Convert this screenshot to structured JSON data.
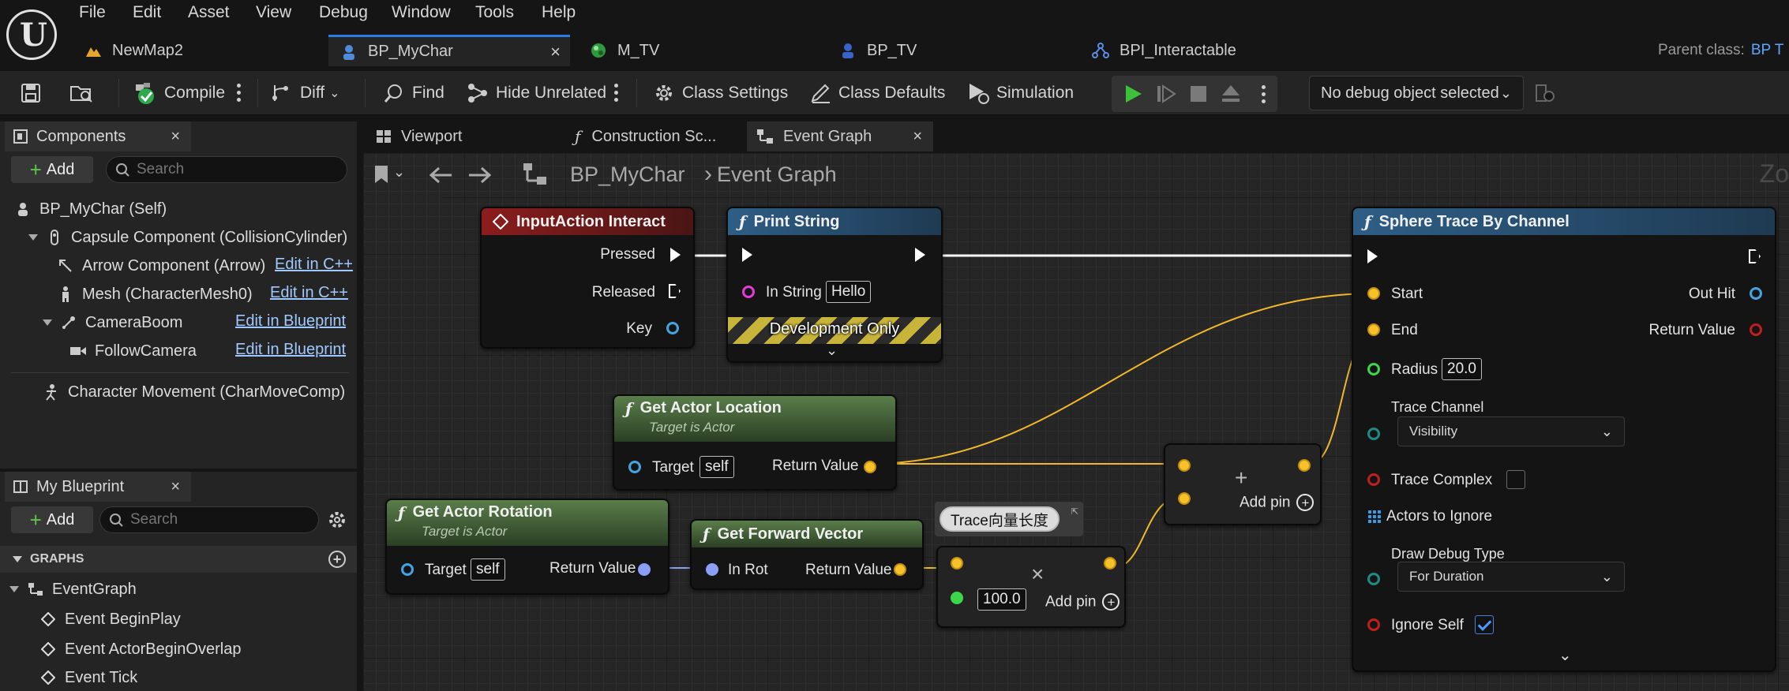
{
  "menubar": {
    "items": [
      "File",
      "Edit",
      "Asset",
      "View",
      "Debug",
      "Window",
      "Tools",
      "Help"
    ]
  },
  "doc_tabs": [
    {
      "label": "NewMap2"
    },
    {
      "label": "BP_MyChar",
      "close": "×"
    },
    {
      "label": "M_TV"
    },
    {
      "label": "BP_TV"
    },
    {
      "label": "BPI_Interactable"
    }
  ],
  "parent_class": {
    "label": "Parent class:",
    "value": "BP T"
  },
  "toolbar": {
    "compile": "Compile",
    "diff": "Diff",
    "find": "Find",
    "hide_unrelated": "Hide Unrelated",
    "class_settings": "Class Settings",
    "class_defaults": "Class Defaults",
    "simulation": "Simulation",
    "debug_object": "No debug object selected"
  },
  "components": {
    "tab_label": "Components",
    "close": "×",
    "add_label": "Add",
    "search_placeholder": "Search",
    "tree": [
      {
        "label": "BP_MyChar (Self)"
      },
      {
        "label": "Capsule Component (CollisionCylinder)"
      },
      {
        "label": "Arrow Component (Arrow)",
        "link": "Edit in C++"
      },
      {
        "label": "Mesh (CharacterMesh0)",
        "link": "Edit in C++"
      },
      {
        "label": "CameraBoom",
        "link": "Edit in Blueprint"
      },
      {
        "label": "FollowCamera",
        "link": "Edit in Blueprint"
      },
      {
        "label": "Character Movement (CharMoveComp)"
      }
    ]
  },
  "my_blueprint": {
    "tab_label": "My Blueprint",
    "close": "×",
    "add_label": "Add",
    "search_placeholder": "Search",
    "graphs_header": "GRAPHS",
    "items": [
      "EventGraph",
      "Event BeginPlay",
      "Event ActorBeginOverlap",
      "Event Tick"
    ]
  },
  "graph_tabs": [
    {
      "label": "Viewport"
    },
    {
      "label": "Construction Sc..."
    },
    {
      "label": "Event Graph",
      "close": "×"
    }
  ],
  "breadcrumb": {
    "root": "BP_MyChar",
    "current": "Event Graph",
    "zoom": "Zo"
  },
  "nodes": {
    "input_action": {
      "title": "InputAction Interact",
      "pins": [
        "Pressed",
        "Released",
        "Key"
      ]
    },
    "print_string": {
      "title": "Print String",
      "in_string_label": "In String",
      "in_string_value": "Hello",
      "dev_only": "Development Only"
    },
    "get_actor_location": {
      "title": "Get Actor Location",
      "subtitle": "Target is Actor",
      "target_label": "Target",
      "target_value": "self",
      "return_label": "Return Value"
    },
    "get_actor_rotation": {
      "title": "Get Actor Rotation",
      "subtitle": "Target is Actor",
      "target_label": "Target",
      "target_value": "self",
      "return_label": "Return Value"
    },
    "get_forward_vector": {
      "title": "Get Forward Vector",
      "in_label": "In Rot",
      "return_label": "Return Value"
    },
    "add_node": {
      "add_pin": "Add pin"
    },
    "multiply_node": {
      "value": "100.0",
      "add_pin": "Add pin"
    },
    "comment": {
      "text": "Trace向量长度"
    },
    "sphere_trace": {
      "title": "Sphere Trace By Channel",
      "start": "Start",
      "end": "End",
      "out_hit": "Out Hit",
      "return_value": "Return Value",
      "radius_label": "Radius",
      "radius_value": "20.0",
      "trace_channel_label": "Trace Channel",
      "trace_channel_value": "Visibility",
      "trace_complex": "Trace Complex",
      "actors_to_ignore": "Actors to Ignore",
      "draw_debug_label": "Draw Debug Type",
      "draw_debug_value": "For Duration",
      "ignore_self": "Ignore Self"
    }
  },
  "colors": {
    "accent": "#2b7de0",
    "event_header": "#8c1d1d",
    "function_header": "#2e5e86",
    "pure_header": "#4c6b3f",
    "wire_vector": "#f0b82a",
    "wire_exec": "#ffffff"
  }
}
